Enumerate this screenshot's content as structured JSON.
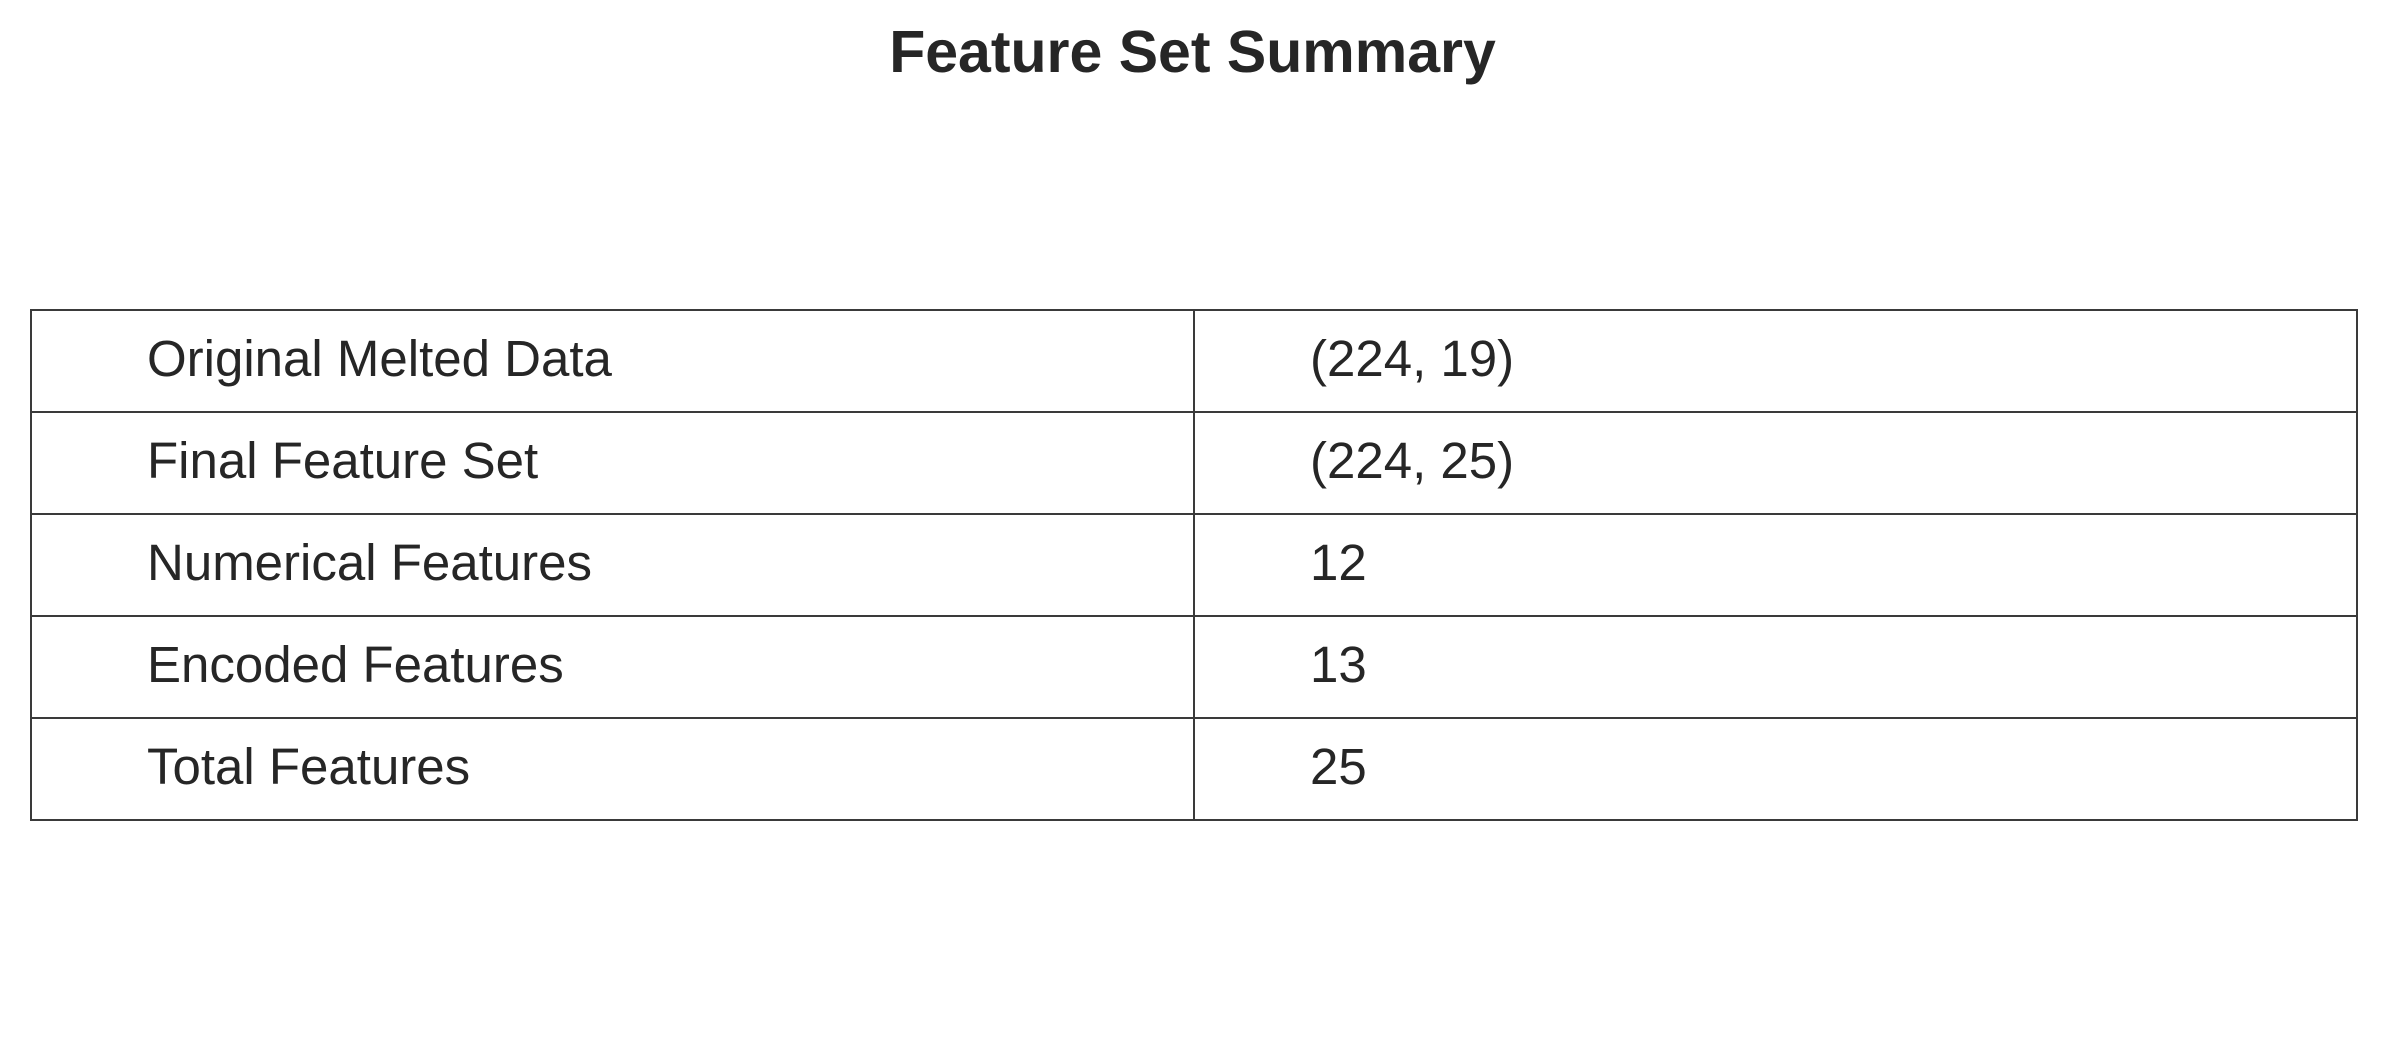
{
  "chart_data": {
    "type": "table",
    "title": "Feature Set Summary",
    "rows": [
      [
        "Original Melted Data",
        "(224, 19)"
      ],
      [
        "Final Feature Set",
        "(224, 25)"
      ],
      [
        "Numerical Features",
        "12"
      ],
      [
        "Encoded Features",
        "13"
      ],
      [
        "Total Features",
        "25"
      ]
    ]
  }
}
